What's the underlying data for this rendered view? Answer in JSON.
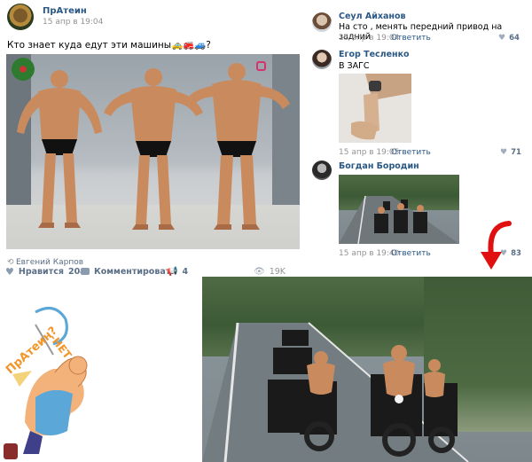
{
  "post": {
    "author": "ПрАтеин",
    "time": "15 апр в 19:04",
    "text": "Кто знает куда едут эти машины🚕🚒🚙?",
    "watermark_text": "",
    "reposted_author": "Евгений Карпов",
    "like_label": "Нравится",
    "like_count": "204",
    "comment_label": "Комментировать",
    "share_count": "4",
    "views": "19K"
  },
  "comments": [
    {
      "author": "Сеул Айханов",
      "text": "На сто , менять передний привод на задний",
      "time": "15 апр в 19:04",
      "reply": "Ответить",
      "likes": "64"
    },
    {
      "author": "Егор Тесленко",
      "text": "В ЗАГС",
      "time": "15 апр в 19:05",
      "reply": "Ответить",
      "likes": "71"
    },
    {
      "author": "Богдан Бородин",
      "text": "",
      "time": "15 апр в 19:40",
      "reply": "Ответить",
      "likes": "83"
    }
  ],
  "cartoon": {
    "bubble_text": "ПрАтеин?",
    "answer_text": "-НЕТ"
  },
  "colors": {
    "link": "#2a5885",
    "meta": "#939393",
    "arrow": "#e01010"
  }
}
